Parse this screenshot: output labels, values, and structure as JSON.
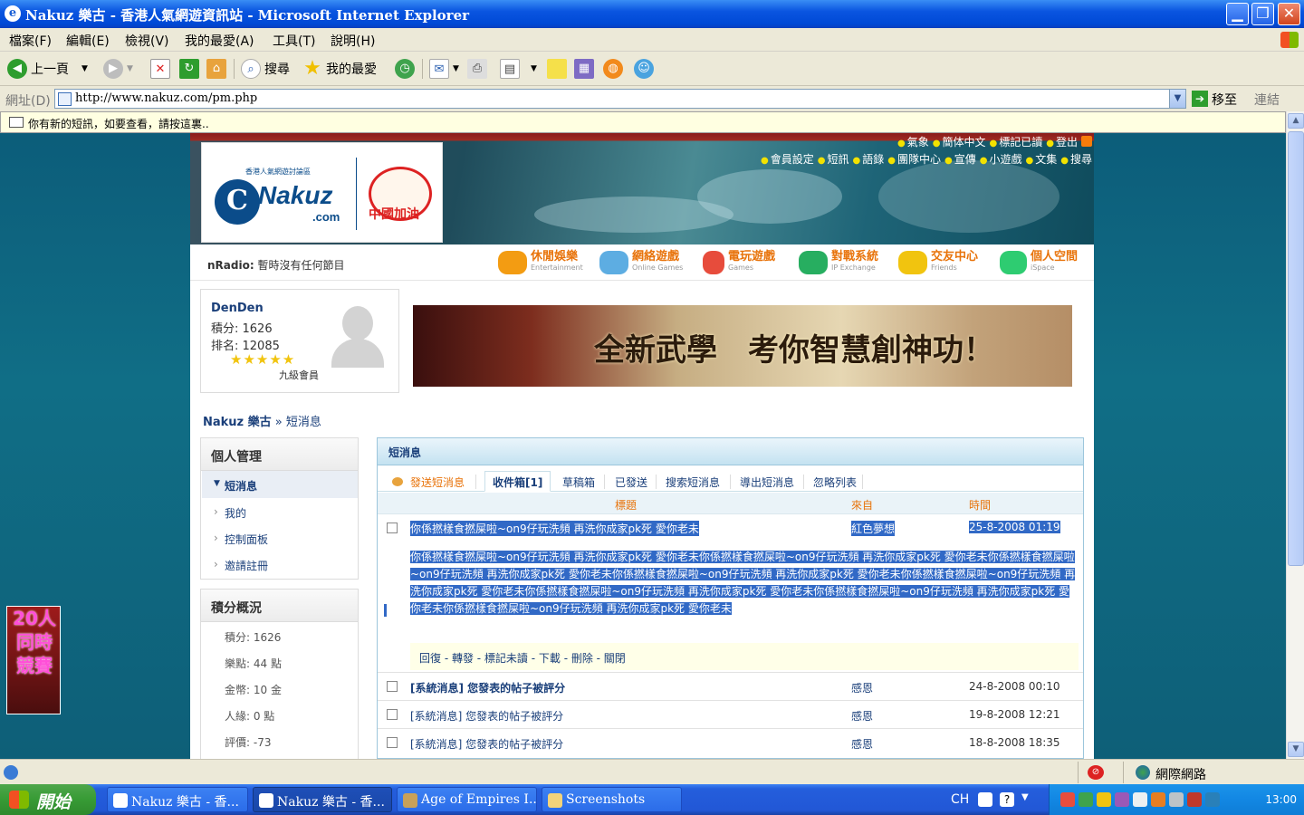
{
  "window": {
    "title": "Nakuz 樂古 - 香港人氣網遊資訊站 - Microsoft Internet Explorer"
  },
  "menu": [
    "檔案(F)",
    "編輯(E)",
    "檢視(V)",
    "我的最愛(A)",
    "工具(T)",
    "說明(H)"
  ],
  "toolbar": {
    "back": "上一頁",
    "search": "搜尋",
    "favorites": "我的最愛"
  },
  "address": {
    "label": "網址(D)",
    "url": "http://www.nakuz.com/pm.php",
    "go": "移至",
    "links": "連結"
  },
  "infobar": "你有新的短訊，如要查看，請按這裏..",
  "site": {
    "logo": {
      "name": "Nakuz",
      "com": ".com",
      "slogan": "香港人氣網遊討論區",
      "china": "中國加油"
    },
    "toplinks_row1": [
      "氣象",
      "簡体中文",
      "標記已讀",
      "登出"
    ],
    "toplinks_row2": [
      "會員設定",
      "短訊",
      "語錄",
      "團隊中心",
      "宣傳",
      "小遊戲",
      "文集",
      "搜尋"
    ],
    "nradio_label": "nRadio:",
    "nradio_text": "暫時沒有任何節目",
    "nav": [
      {
        "label": "休閒娛樂",
        "sub": "Entertainment",
        "color": "#f39c12"
      },
      {
        "label": "網絡遊戲",
        "sub": "Online Games",
        "color": "#5dade2"
      },
      {
        "label": "電玩遊戲",
        "sub": "Games",
        "color": "#e74c3c"
      },
      {
        "label": "對戰系統",
        "sub": "IP Exchange",
        "color": "#27ae60"
      },
      {
        "label": "交友中心",
        "sub": "Friends",
        "color": "#f1c40f"
      },
      {
        "label": "個人空間",
        "sub": "iSpace",
        "color": "#2ecc71"
      }
    ],
    "user": {
      "name": "DenDen",
      "points": "積分: 1626",
      "rank": "排名: 12085",
      "stars": "★★★★★",
      "level": "九級會員"
    },
    "ad_text": "全新武學　考你智慧創神功！",
    "breadcrumb": {
      "home": "Nakuz 樂古",
      "sep": "»",
      "current": "短消息"
    },
    "sidebar": {
      "personal_title": "個人管理",
      "personal_items": [
        "短消息",
        "我的",
        "控制面板",
        "邀請註冊"
      ],
      "points_title": "積分概況",
      "points_items": [
        "積分: 1626",
        "樂點: 44 點",
        "金幣: 10 金",
        "人緣: 0 點",
        "評價: -73"
      ]
    },
    "pm": {
      "title": "短消息",
      "tabs": [
        "發送短消息",
        "收件箱[1]",
        "草稿箱",
        "已發送",
        "搜索短消息",
        "導出短消息",
        "忽略列表"
      ],
      "columns": {
        "subject": "標題",
        "from": "來自",
        "time": "時間"
      },
      "messages": [
        {
          "subject": "你係撚樣食撚屎啦~on9仔玩洗頻 再洗你成家pk死 愛你老未",
          "from": "紅色夢想",
          "time": "25-8-2008 01:19"
        },
        {
          "subject": "[系統消息] 您發表的帖子被評分",
          "from": "感恩",
          "time": "24-8-2008 00:10"
        },
        {
          "subject": "[系統消息] 您發表的帖子被評分",
          "from": "感恩",
          "time": "19-8-2008 12:21"
        },
        {
          "subject": "[系統消息] 您發表的帖子被評分",
          "from": "感恩",
          "time": "18-8-2008 18:35"
        }
      ],
      "body": "你係撚樣食撚屎啦~on9仔玩洗頻 再洗你成家pk死 愛你老未你係撚樣食撚屎啦~on9仔玩洗頻 再洗你成家pk死 愛你老未你係撚樣食撚屎啦~on9仔玩洗頻 再洗你成家pk死 愛你老未你係撚樣食撚屎啦~on9仔玩洗頻 再洗你成家pk死 愛你老未你係撚樣食撚屎啦~on9仔玩洗頻 再洗你成家pk死 愛你老未你係撚樣食撚屎啦~on9仔玩洗頻 再洗你成家pk死 愛你老未你係撚樣食撚屎啦~on9仔玩洗頻 再洗你成家pk死 愛你老未你係撚樣食撚屎啦~on9仔玩洗頻 再洗你成家pk死 愛你老未",
      "actions": "回復 - 轉發 - 標記未讀 - 下載 - 刪除 - 關閉"
    },
    "float_ad": "20人同時競賽"
  },
  "status": {
    "zone": "網際網路"
  },
  "taskbar": {
    "start": "開始",
    "tasks": [
      "Nakuz 樂古 - 香...",
      "Nakuz 樂古 - 香...",
      "Age of Empires I...",
      "Screenshots"
    ],
    "lang": "CH",
    "clock": "13:00"
  }
}
